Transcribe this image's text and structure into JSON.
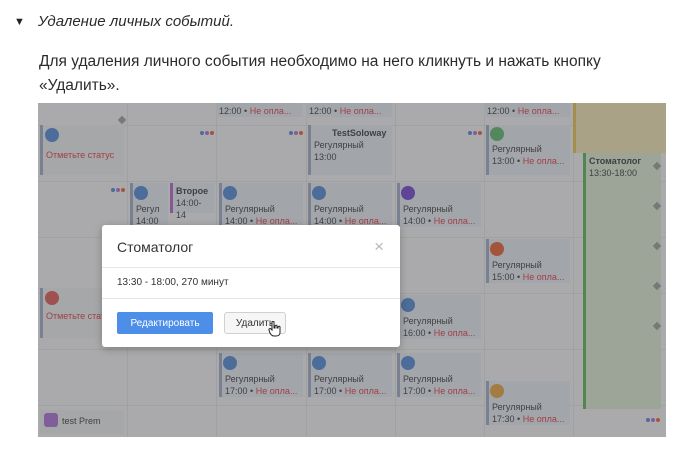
{
  "doc": {
    "summary_marker": "▼",
    "summary_text": "Удаление личных событий.",
    "paragraph": "Для удаления личного события необходимо на него кликнуть и нажать кнопку «Удалить»."
  },
  "calendar": {
    "events": [
      {
        "id": "e1",
        "line1": "12:00 •",
        "line2": "Не опла...",
        "type": "time_unpaid"
      },
      {
        "id": "e2",
        "line1": "12:00 •",
        "line2": "Не опла...",
        "type": "time_unpaid"
      },
      {
        "id": "e3",
        "line1": "12:00 •",
        "line2": "Не опла...",
        "type": "time_unpaid"
      },
      {
        "id": "e4",
        "name": "TestSoloway",
        "line1": "Регулярный",
        "line2": "13:00"
      },
      {
        "id": "e5",
        "line1": "Регулярный",
        "line2": "13:00 •",
        "line3": "Не опла..."
      },
      {
        "id": "e6",
        "name": "Стоматолог",
        "line1": "13:30-18:00"
      },
      {
        "id": "e7",
        "line1": "Отметьте статус"
      },
      {
        "id": "e8",
        "line1": "Регул",
        "line2": "14:00"
      },
      {
        "id": "e9",
        "name": "Второе",
        "line1": "14:00-14"
      },
      {
        "id": "e10",
        "line1": "Регулярный",
        "line2": "14:00 •",
        "line3": "Не опла..."
      },
      {
        "id": "e11",
        "line1": "Регулярный",
        "line2": "14:00 •",
        "line3": "Не опла..."
      },
      {
        "id": "e12",
        "line1": "Регулярный",
        "line2": "14:00 •",
        "line3": "Не опла..."
      },
      {
        "id": "e13",
        "line1": "Регулярный",
        "line2": "15:00 •",
        "line3": "Не опла..."
      },
      {
        "id": "e14",
        "line1": "Отметьте стату"
      },
      {
        "id": "e15",
        "line1": "Регулярный",
        "line2": "16:00 •",
        "line3": "Не опла..."
      },
      {
        "id": "e16",
        "line1": "Регулярный",
        "line2": "17:00 •",
        "line3": "Не опла..."
      },
      {
        "id": "e17",
        "line1": "Регулярный",
        "line2": "17:00 •",
        "line3": "Не опла..."
      },
      {
        "id": "e18",
        "line1": "Регулярный",
        "line2": "17:00 •",
        "line3": "Не опла..."
      },
      {
        "id": "e19",
        "line1": "Регулярный",
        "line2": "17:30 •",
        "line3": "Не опла..."
      },
      {
        "id": "e20",
        "name": "test Prem"
      }
    ]
  },
  "modal": {
    "title": "Стоматолог",
    "close_label": "×",
    "time_info": "13:30 - 18:00, 270 минут",
    "edit_label": "Редактировать",
    "delete_label": "Удалить"
  },
  "colors": {
    "accent_blue": "#4c8ee8",
    "unpaid_red": "#e2333c",
    "dentist_green": "#54b24f"
  }
}
